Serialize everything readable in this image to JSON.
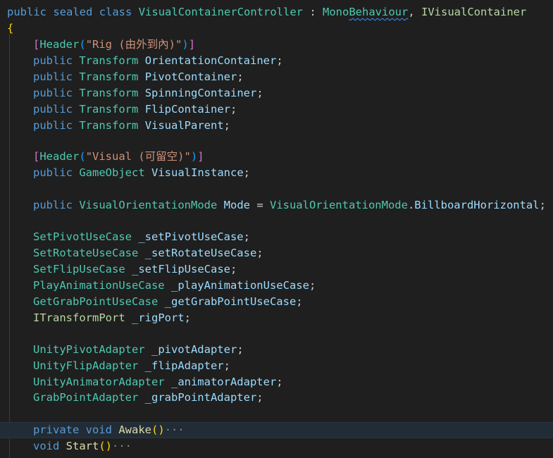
{
  "class_decl": {
    "kw_public": "public",
    "kw_sealed": "sealed",
    "kw_class": "class",
    "class_name": "VisualContainerController",
    "colon": " : ",
    "base_pre": "Mono",
    "base_squiggle": "Behaviour",
    "comma": ", ",
    "interface": "IVisualContainer"
  },
  "open_brace": "{",
  "header_rig": {
    "bracket_open": "[",
    "attr": "Header",
    "paren_open": "(",
    "text": "\"Rig (由外到內)\"",
    "paren_close": ")",
    "bracket_close": "]"
  },
  "rig_fields": [
    {
      "mod": "public",
      "type": "Transform",
      "name": "OrientationContainer"
    },
    {
      "mod": "public",
      "type": "Transform",
      "name": "PivotContainer"
    },
    {
      "mod": "public",
      "type": "Transform",
      "name": "SpinningContainer"
    },
    {
      "mod": "public",
      "type": "Transform",
      "name": "FlipContainer"
    },
    {
      "mod": "public",
      "type": "Transform",
      "name": "VisualParent"
    }
  ],
  "header_visual": {
    "bracket_open": "[",
    "attr": "Header",
    "paren_open": "(",
    "text": "\"Visual (可留空)\"",
    "paren_close": ")",
    "bracket_close": "]"
  },
  "visual_field": {
    "mod": "public",
    "type": "GameObject",
    "name": "VisualInstance"
  },
  "mode_field": {
    "mod": "public",
    "type": "VisualOrientationMode",
    "name": "Mode",
    "assign": " = ",
    "value_type": "VisualOrientationMode",
    "dot": ".",
    "value_member": "BillboardHorizontal"
  },
  "usecase_fields": [
    {
      "type": "SetPivotUseCase",
      "name": "_setPivotUseCase"
    },
    {
      "type": "SetRotateUseCase",
      "name": "_setRotateUseCase"
    },
    {
      "type": "SetFlipUseCase",
      "name": "_setFlipUseCase"
    },
    {
      "type": "PlayAnimationUseCase",
      "name": "_playAnimationUseCase"
    },
    {
      "type": "GetGrabPointUseCase",
      "name": "_getGrabPointUseCase"
    },
    {
      "type": "ITransformPort",
      "name": "_rigPort"
    }
  ],
  "adapter_fields": [
    {
      "type": "UnityPivotAdapter",
      "name": "_pivotAdapter"
    },
    {
      "type": "UnityFlipAdapter",
      "name": "_flipAdapter"
    },
    {
      "type": "UnityAnimatorAdapter",
      "name": "_animatorAdapter"
    },
    {
      "type": "GrabPointAdapter",
      "name": "_grabPointAdapter"
    }
  ],
  "methods": [
    {
      "mod1": "private",
      "mod2": "void",
      "name": "Awake",
      "parens": "()",
      "fold": "···"
    },
    {
      "mod1": "",
      "mod2": "void",
      "name": "Start",
      "parens": "()",
      "fold": "···"
    }
  ],
  "semicolon": ";",
  "theme": {
    "background": "#1f1f1f",
    "keyword": "#569cd6",
    "type": "#4ec9b0",
    "identifier": "#9cdcfe",
    "string": "#ce9178",
    "function": "#dcdcaa"
  }
}
